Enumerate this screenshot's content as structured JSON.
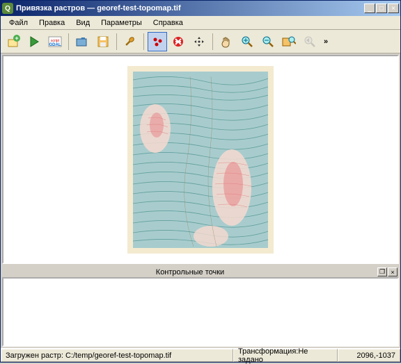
{
  "titlebar": {
    "app_icon_letter": "Q",
    "title": "Привязка растров — georef-test-topomap.tif",
    "minimize": "_",
    "maximize": "□",
    "close": "×"
  },
  "menu": {
    "file": "Файл",
    "edit": "Правка",
    "view": "Вид",
    "params": "Параметры",
    "help": "Справка"
  },
  "toolbar_icons": {
    "open_raster": "open-raster-icon",
    "start": "start-georef-icon",
    "gdal_script": "gdal-script-icon",
    "load_gcp": "load-gcp-icon",
    "save_gcp": "save-gcp-icon",
    "transform_settings": "transform-settings-icon",
    "add_point": "add-point-icon",
    "delete_point": "delete-point-icon",
    "move_point": "move-point-icon",
    "pan": "pan-icon",
    "zoom_in": "zoom-in-icon",
    "zoom_out": "zoom-out-icon",
    "zoom_layer": "zoom-layer-icon",
    "zoom_last": "zoom-last-icon",
    "overflow": "»"
  },
  "panel": {
    "title": "Контрольные точки",
    "undock": "❐",
    "close": "×"
  },
  "status": {
    "loaded": "Загружен растр: C:/temp/georef-test-topomap.tif",
    "transform": "Трансформация:Не задано",
    "coords": "2096,-1037"
  }
}
